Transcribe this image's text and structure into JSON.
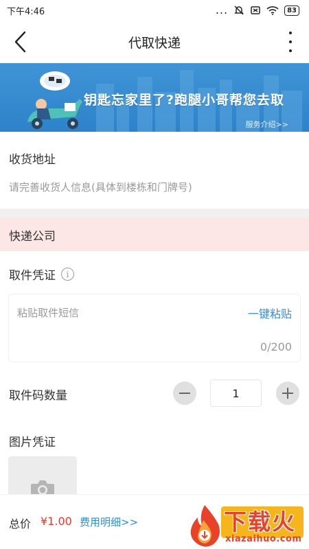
{
  "status_bar": {
    "time": "下午4:46",
    "dots": "...",
    "battery": "83"
  },
  "nav": {
    "title": "代取快递"
  },
  "banner": {
    "slogan": "钥匙忘家里了?跑腿小哥帮您去取",
    "service_link": "服务介绍>>",
    "colors": {
      "background": "#2e82c9",
      "text": "#ffffff"
    }
  },
  "address": {
    "title": "收货地址",
    "placeholder": "请完善收货人信息(具体到楼栋和门牌号)"
  },
  "company": {
    "label": "快递公司",
    "highlight_color": "#fde6e6"
  },
  "voucher": {
    "title": "取件凭证",
    "info_icon": "i",
    "sms_placeholder": "粘贴取件短信",
    "paste_button": "一键粘贴",
    "char_count": "0/200"
  },
  "quantity": {
    "label": "取件码数量",
    "value": "1"
  },
  "photo": {
    "title": "图片凭证"
  },
  "bottom": {
    "total_label": "总价",
    "total_price": "¥1.00",
    "fee_detail": "费用明细>>",
    "accent_price": "#e23b2f",
    "accent_link": "#2c8fd8",
    "submit_color": "#f7b51c"
  },
  "watermark": {
    "brand": "下载火",
    "domain": "xiazaihuo.com"
  }
}
